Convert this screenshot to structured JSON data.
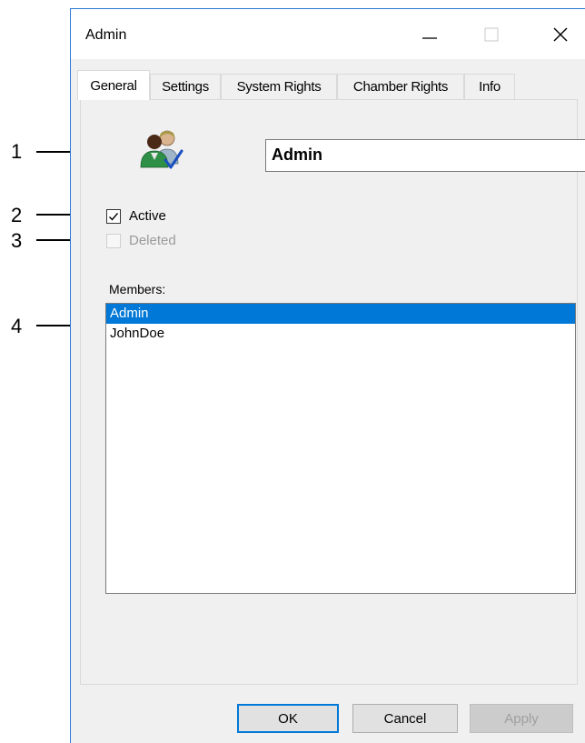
{
  "callouts": [
    "1",
    "2",
    "3",
    "4"
  ],
  "window": {
    "title": "Admin",
    "controls": {
      "minimize": "minimize-icon",
      "maximize": "maximize-icon",
      "close": "close-icon"
    }
  },
  "tabs": [
    {
      "label": "General",
      "active": true
    },
    {
      "label": "Settings",
      "active": false
    },
    {
      "label": "System Rights",
      "active": false
    },
    {
      "label": "Chamber Rights",
      "active": false
    },
    {
      "label": "Info",
      "active": false
    }
  ],
  "general": {
    "group_icon": "user-group-icon",
    "name_value": "Admin",
    "active": {
      "label": "Active",
      "checked": true
    },
    "deleted": {
      "label": "Deleted",
      "checked": false,
      "disabled": true
    },
    "members_label": "Members:",
    "members": [
      {
        "name": "Admin",
        "selected": true
      },
      {
        "name": "JohnDoe",
        "selected": false
      }
    ]
  },
  "buttons": {
    "ok": "OK",
    "cancel": "Cancel",
    "apply": "Apply"
  },
  "colors": {
    "accent": "#0078d7",
    "window_border": "#2b79d6"
  }
}
